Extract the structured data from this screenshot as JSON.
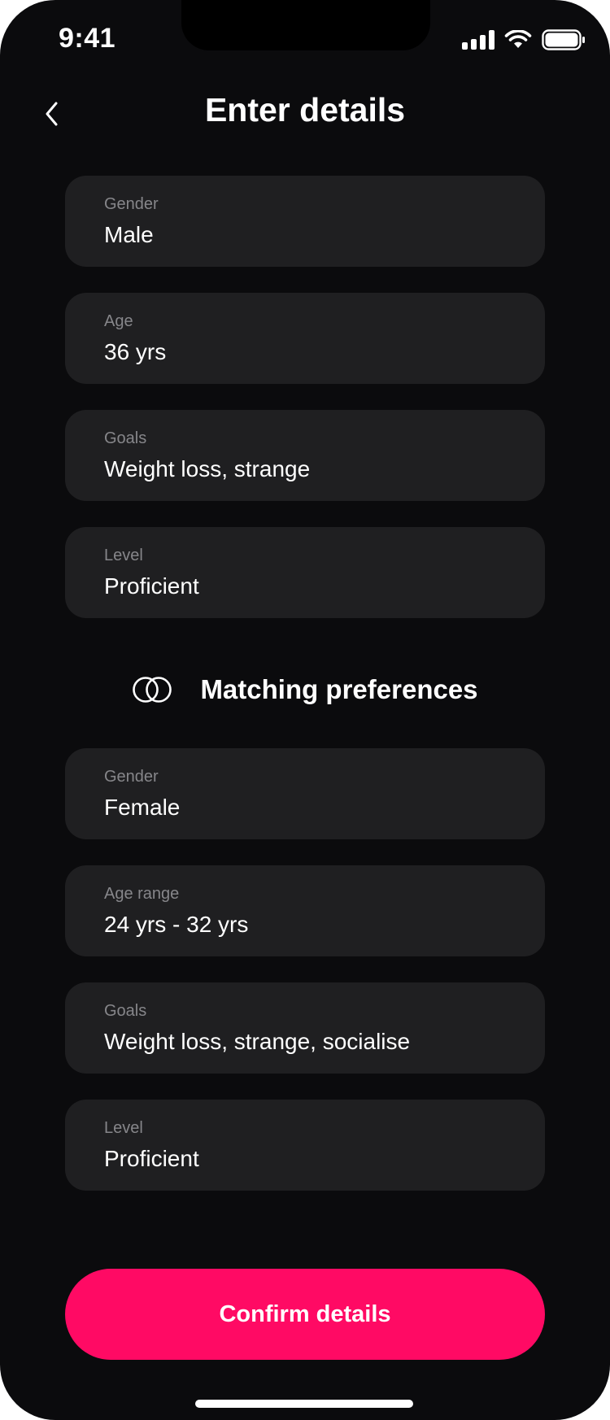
{
  "status_bar": {
    "time": "9:41",
    "icons": [
      "signal-icon",
      "wifi-icon",
      "battery-icon"
    ]
  },
  "header": {
    "back_icon": "chevron-left-icon",
    "title": "Enter details"
  },
  "my_details": [
    {
      "label": "Gender",
      "value": "Male"
    },
    {
      "label": "Age",
      "value": "36 yrs"
    },
    {
      "label": "Goals",
      "value": "Weight loss, strange"
    },
    {
      "label": "Level",
      "value": "Proficient"
    }
  ],
  "matching": {
    "icon": "linked-rings-icon",
    "title": "Matching preferences",
    "fields": [
      {
        "label": "Gender",
        "value": "Female"
      },
      {
        "label": "Age range",
        "value": "24 yrs - 32 yrs"
      },
      {
        "label": "Goals",
        "value": "Weight loss, strange, socialise"
      },
      {
        "label": "Level",
        "value": "Proficient"
      }
    ]
  },
  "footer": {
    "confirm_label": "Confirm details"
  },
  "colors": {
    "background": "#0b0b0d",
    "card": "#1f1f21",
    "label": "#86868a",
    "accent": "#ff0a64"
  }
}
